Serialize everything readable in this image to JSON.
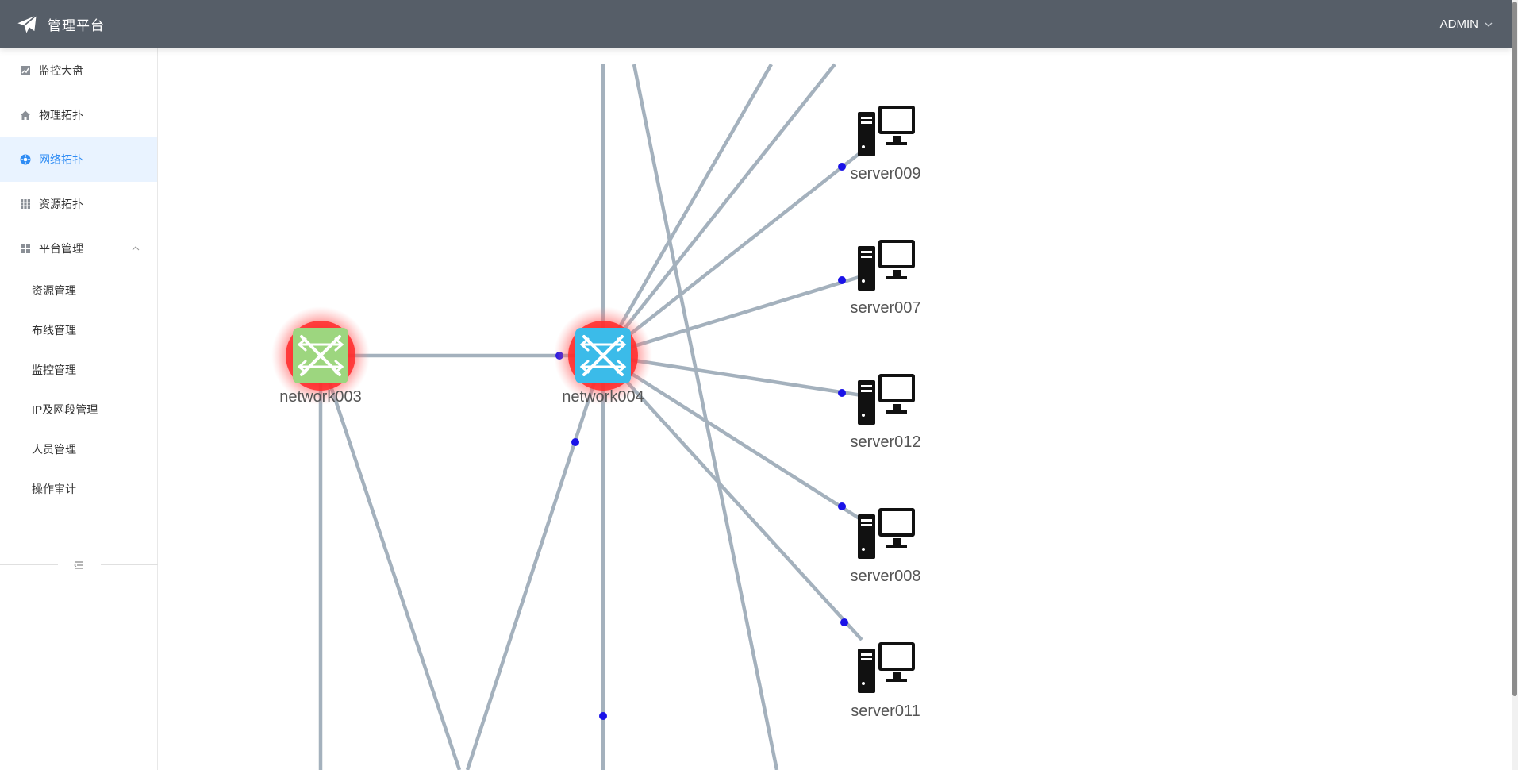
{
  "header": {
    "app_title": "管理平台",
    "user_name": "ADMIN",
    "logo_icon": "paper-plane-icon"
  },
  "sidebar": {
    "items": [
      {
        "label": "监控大盘",
        "icon": "line-chart-icon"
      },
      {
        "label": "物理拓扑",
        "icon": "home-icon"
      },
      {
        "label": "网络拓扑",
        "icon": "network-icon",
        "active": true
      },
      {
        "label": "资源拓扑",
        "icon": "grid-icon"
      },
      {
        "label": "平台管理",
        "icon": "dashboard-icon",
        "expanded": true
      }
    ],
    "submenu": [
      {
        "label": "资源管理"
      },
      {
        "label": "布线管理"
      },
      {
        "label": "监控管理"
      },
      {
        "label": "IP及网段管理"
      },
      {
        "label": "人员管理"
      },
      {
        "label": "操作审计"
      }
    ]
  },
  "topology": {
    "switches": [
      {
        "name": "network003",
        "color": "#9dd67f"
      },
      {
        "name": "network004",
        "color": "#3bbbe9"
      }
    ],
    "servers": [
      {
        "name": "server009"
      },
      {
        "name": "server007"
      },
      {
        "name": "server012"
      },
      {
        "name": "server008"
      },
      {
        "name": "server011"
      }
    ]
  },
  "colors": {
    "header_bg": "#565e68",
    "accent": "#2f8cf4",
    "active_bg": "#e9f3ff",
    "link": "#a4b1bd",
    "alarm_glow": "#ff3b3b",
    "endpoint_dot": "#1a12e8"
  }
}
